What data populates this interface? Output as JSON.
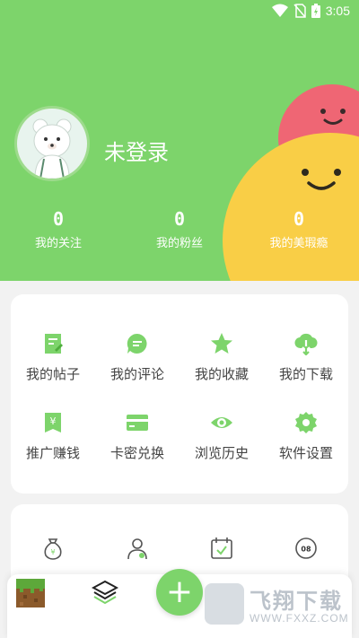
{
  "status_bar": {
    "time": "3:05",
    "icons": [
      "wifi-icon",
      "no-sim-icon",
      "battery-icon"
    ]
  },
  "profile": {
    "login_text": "未登录",
    "avatar_icon": "bear-avatar-icon"
  },
  "stats": [
    {
      "value": "0",
      "label": "我的关注"
    },
    {
      "value": "0",
      "label": "我的粉丝"
    },
    {
      "value": "0",
      "label": "我的美瑕瘾"
    }
  ],
  "menu": [
    {
      "label": "我的帖子",
      "icon": "post-icon"
    },
    {
      "label": "我的评论",
      "icon": "comment-icon"
    },
    {
      "label": "我的收藏",
      "icon": "star-icon"
    },
    {
      "label": "我的下载",
      "icon": "download-icon"
    },
    {
      "label": "推广赚钱",
      "icon": "yuan-ticket-icon"
    },
    {
      "label": "卡密兑换",
      "icon": "card-icon"
    },
    {
      "label": "浏览历史",
      "icon": "eye-icon"
    },
    {
      "label": "软件设置",
      "icon": "gear-icon"
    }
  ],
  "secondary_icons": [
    "money-bag-icon",
    "user-badge-icon",
    "calendar-check-icon",
    "clock-08-icon"
  ],
  "secondary_clock_text": "08",
  "bottom_nav": {
    "fab_label": "+",
    "items": [
      "grass-block-icon",
      "layers-icon",
      "add-icon"
    ]
  },
  "watermark": {
    "title": "飞翔下载",
    "url": "WWW.FXXZ.COM"
  },
  "colors": {
    "accent": "#7dd46b",
    "pink": "#ef6674",
    "yellow": "#f9ce46"
  }
}
